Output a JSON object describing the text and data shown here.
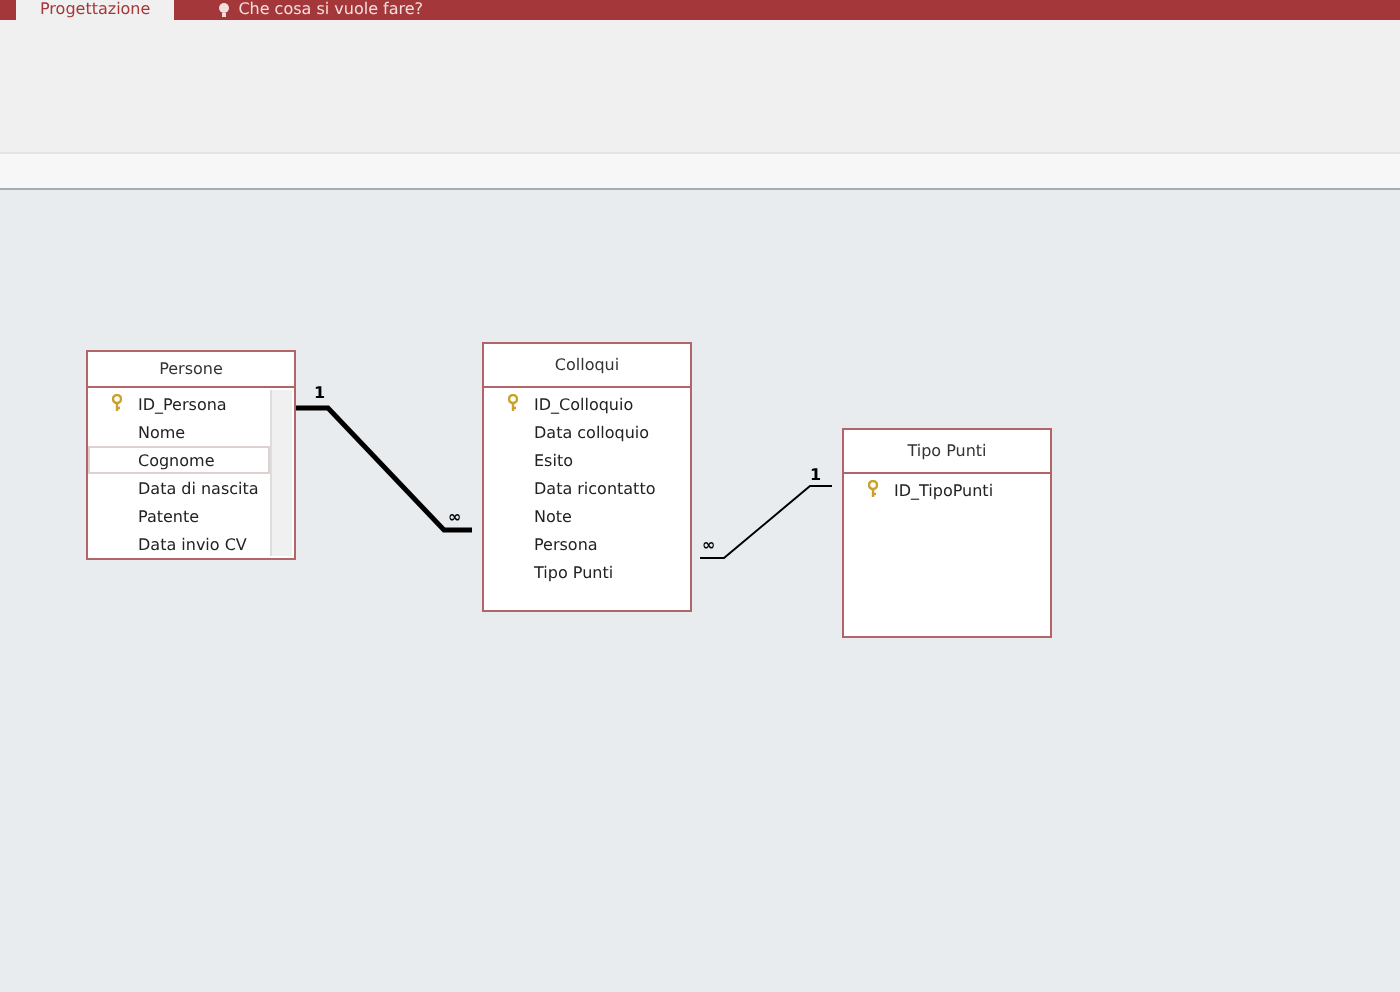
{
  "ribbon_tabs": [
    {
      "label": "Progettazione",
      "selected": true,
      "kind": "tab"
    },
    {
      "label": "Che cosa si vuole fare?",
      "selected": false,
      "kind": "search"
    }
  ],
  "tables": [
    {
      "title": "Persone",
      "scrollable": true,
      "fields": [
        {
          "name": "ID_Persona",
          "primary_key": true,
          "selected": false
        },
        {
          "name": "Nome",
          "primary_key": false,
          "selected": false
        },
        {
          "name": "Cognome",
          "primary_key": false,
          "selected": true
        },
        {
          "name": "Data di nascita",
          "primary_key": false,
          "selected": false
        },
        {
          "name": "Patente",
          "primary_key": false,
          "selected": false
        },
        {
          "name": "Data invio CV",
          "primary_key": false,
          "selected": false
        }
      ]
    },
    {
      "title": "Colloqui",
      "scrollable": false,
      "fields": [
        {
          "name": "ID_Colloquio",
          "primary_key": true,
          "selected": false
        },
        {
          "name": "Data colloquio",
          "primary_key": false,
          "selected": false
        },
        {
          "name": "Esito",
          "primary_key": false,
          "selected": false
        },
        {
          "name": "Data ricontatto",
          "primary_key": false,
          "selected": false
        },
        {
          "name": "Note",
          "primary_key": false,
          "selected": false
        },
        {
          "name": "Persona",
          "primary_key": false,
          "selected": false
        },
        {
          "name": "Tipo Punti",
          "primary_key": false,
          "selected": false
        }
      ]
    },
    {
      "title": "Tipo Punti",
      "scrollable": false,
      "fields": [
        {
          "name": "ID_TipoPunti",
          "primary_key": true,
          "selected": false
        }
      ]
    }
  ],
  "relationships": [
    {
      "one_label": "1",
      "many_label": "∞",
      "selected": true
    },
    {
      "one_label": "1",
      "many_label": "∞",
      "selected": false
    }
  ]
}
